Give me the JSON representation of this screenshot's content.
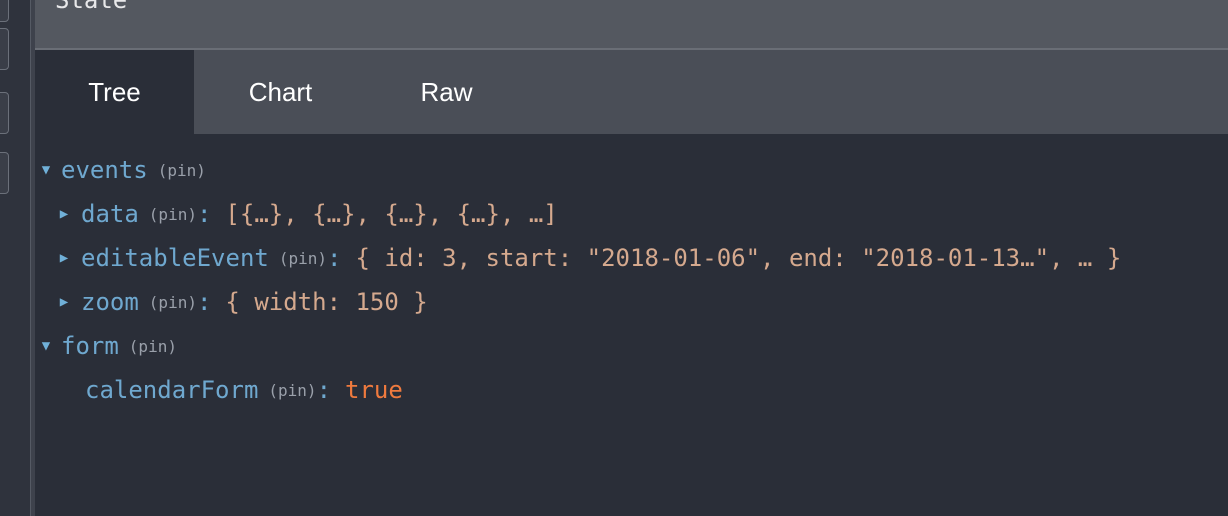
{
  "panel": {
    "title": "State"
  },
  "tabs": [
    {
      "label": "Tree"
    },
    {
      "label": "Chart"
    },
    {
      "label": "Raw"
    }
  ],
  "tree": {
    "events": {
      "key": "events",
      "pin": "(pin)",
      "arrow": "▼",
      "children": {
        "data": {
          "key": "data",
          "pin": "(pin)",
          "arrow": "▶",
          "colon": ":",
          "value": "[{…}, {…}, {…}, {…}, …]"
        },
        "editableEvent": {
          "key": "editableEvent",
          "pin": "(pin)",
          "arrow": "▶",
          "colon": ":",
          "value": "{ id: 3, start: \"2018-01-06\", end: \"2018-01-13…\", … }"
        },
        "zoom": {
          "key": "zoom",
          "pin": "(pin)",
          "arrow": "▶",
          "colon": ":",
          "value": "{ width: 150 }"
        }
      }
    },
    "form": {
      "key": "form",
      "pin": "(pin)",
      "arrow": "▼",
      "children": {
        "calendarForm": {
          "key": "calendarForm",
          "pin": "(pin)",
          "colon": ":",
          "value": "true"
        }
      }
    }
  },
  "colors": {
    "background": "#2a2e38",
    "key": "#6fa8cf",
    "value": "#d5a98e",
    "boolean": "#ef7a3e",
    "header": "#545860",
    "tabs": "#4a4e57"
  }
}
